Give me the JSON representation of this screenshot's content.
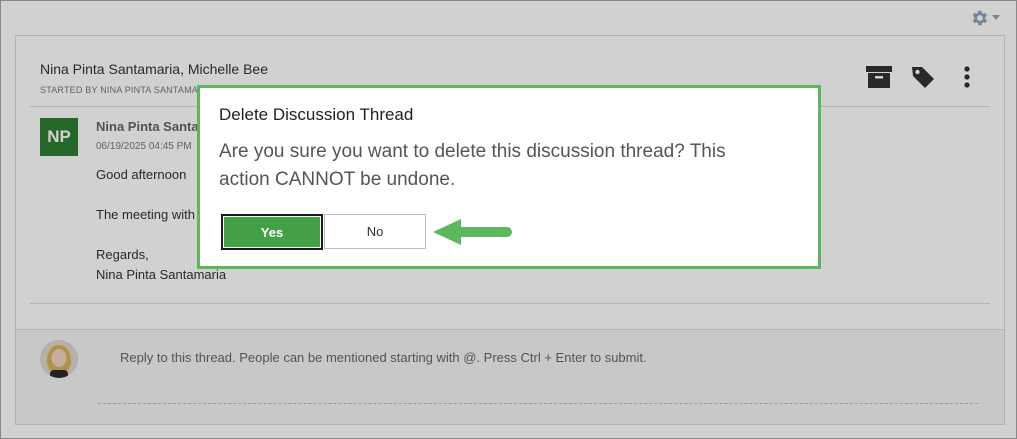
{
  "thread": {
    "participants": "Nina Pinta Santamaria, Michelle Bee",
    "started_by": "STARTED BY NINA PINTA SANTAMA"
  },
  "message": {
    "avatar_initials": "NP",
    "author": "Nina Pinta Santa",
    "timestamp": "06/19/2025 04:45 PM",
    "lines": [
      "Good afternoon",
      "The meeting with",
      "Regards,",
      "Nina Pinta Santamaria"
    ]
  },
  "reply": {
    "placeholder": "Reply to this thread. People can be mentioned starting with @. Press Ctrl + Enter to submit."
  },
  "dialog": {
    "title": "Delete Discussion Thread",
    "message": "Are you sure you want to delete this discussion thread? This action CANNOT be undone.",
    "yes_label": "Yes",
    "no_label": "No"
  },
  "icons": {
    "settings": "gear-icon",
    "settings_menu": "caret-down-icon",
    "archive": "archive-icon",
    "tag": "tag-icon",
    "more": "more-vertical-icon",
    "annotation": "arrow-left-icon"
  },
  "colors": {
    "accent_green": "#5cb85c",
    "yes_button": "#43a047",
    "avatar_green": "#2e7d32",
    "gear_blue": "#8aa4bf"
  }
}
